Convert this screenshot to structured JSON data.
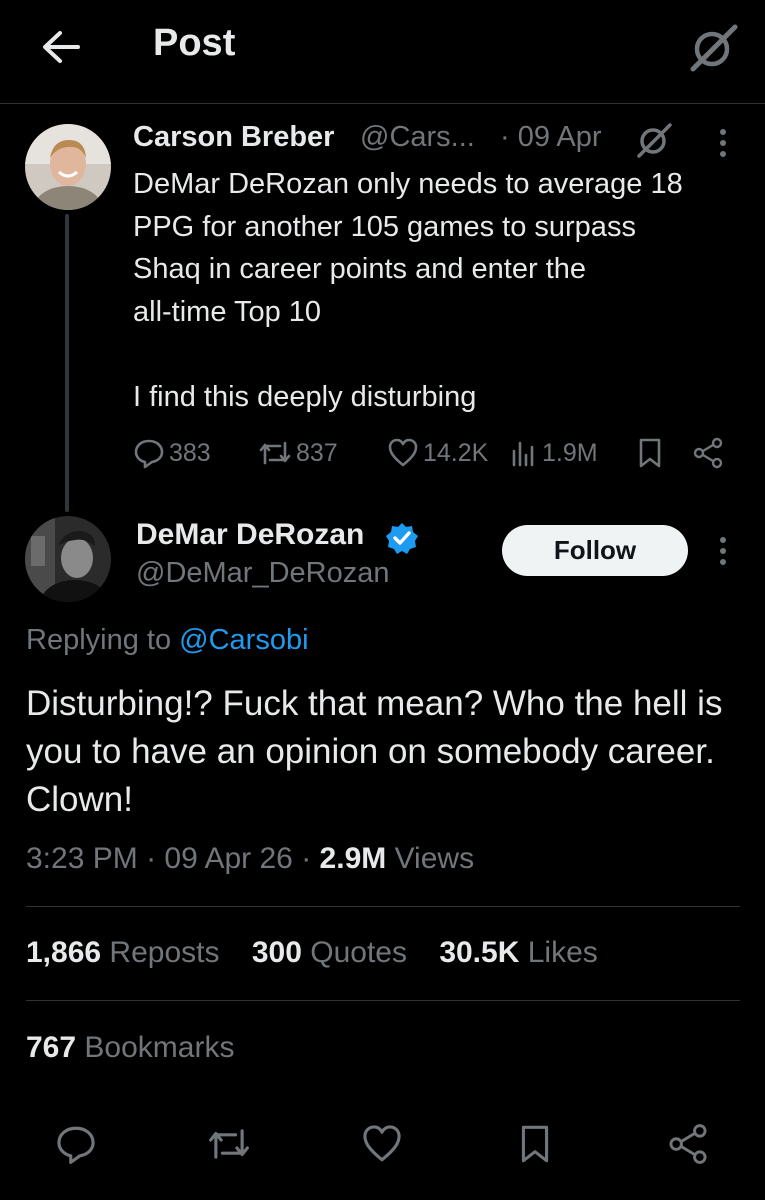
{
  "header": {
    "title": "Post",
    "back_icon": "arrow-left-icon",
    "grok_icon": "grok-icon"
  },
  "parent_tweet": {
    "author_name": "Carson Breber",
    "author_handle": "@Cars...",
    "date": "· 09 Apr",
    "text_lines": [
      "DeMar DeRozan only needs to average 18",
      "PPG for another 105 games to surpass",
      "Shaq in career points and enter the",
      "all-time Top 10",
      "I find this deeply disturbing"
    ],
    "replies": "383",
    "reposts": "837",
    "likes": "14.2K",
    "views": "1.9M"
  },
  "main_tweet": {
    "author_name": "DeMar DeRozan",
    "author_handle": "@DeMar_DeRozan",
    "follow_label": "Follow",
    "replying_prefix": "Replying to",
    "replying_mention": "@Carsobi",
    "text": "Disturbing!? Fuck that mean? Who the hell is you to have an opinion on somebody career. Clown!",
    "time": "3:23 PM",
    "date": "09 Apr 26",
    "views_count": "2.9M",
    "views_label": "Views",
    "reposts_count": "1,866",
    "reposts_label": "Reposts",
    "quotes_count": "300",
    "quotes_label": "Quotes",
    "likes_count": "30.5K",
    "likes_label": "Likes",
    "bookmarks_count": "767",
    "bookmarks_label": "Bookmarks"
  },
  "colors": {
    "background": "#000000",
    "text": "#e7e9ea",
    "muted": "#71767b",
    "link": "#1d9bf0",
    "verified": "#1d9bf0",
    "divider": "#2f3336"
  }
}
